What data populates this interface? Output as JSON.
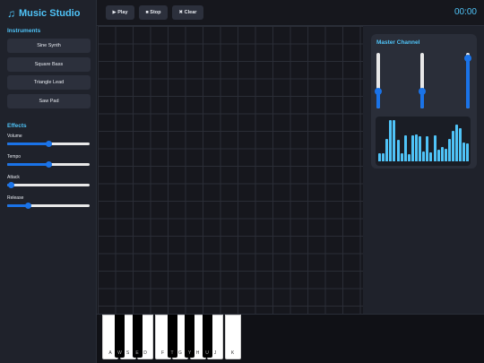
{
  "app": {
    "title": "Music Studio",
    "logo_glyph": "♫"
  },
  "toolbar": {
    "play_label": "▶ Play",
    "stop_label": "■ Stop",
    "clear_label": "✖ Clear",
    "timer": "00:00"
  },
  "sidebar": {
    "instruments_title": "Instruments",
    "instruments": [
      "Sine Synth",
      "Square Bass",
      "Triangle Lead",
      "Saw Pad"
    ],
    "effects_title": "Effects",
    "effects": [
      {
        "label": "Volume",
        "value": 0.5
      },
      {
        "label": "Tempo",
        "value": 0.5
      },
      {
        "label": "Attack",
        "value": 0.05
      },
      {
        "label": "Release",
        "value": 0.26
      }
    ]
  },
  "master": {
    "title": "Master Channel",
    "channels": [
      0.3,
      0.3,
      0.9
    ],
    "visualizer_levels": [
      0.2,
      0.2,
      0.55,
      1.0,
      1.0,
      0.52,
      0.2,
      0.62,
      0.18,
      0.62,
      0.65,
      0.6,
      0.25,
      0.6,
      0.22,
      0.62,
      0.28,
      0.35,
      0.3,
      0.55,
      0.75,
      0.9,
      0.8,
      0.45,
      0.43
    ]
  },
  "keyboard": {
    "white_keys": [
      "A",
      "S",
      "D",
      "F",
      "G",
      "H",
      "J",
      "K"
    ],
    "black_keys": [
      "W",
      "E",
      "T",
      "Y",
      "U"
    ]
  },
  "colors": {
    "accent": "#4fc3f7",
    "slider": "#1a73e8",
    "panel": "#1f222b",
    "background": "#16171d"
  }
}
